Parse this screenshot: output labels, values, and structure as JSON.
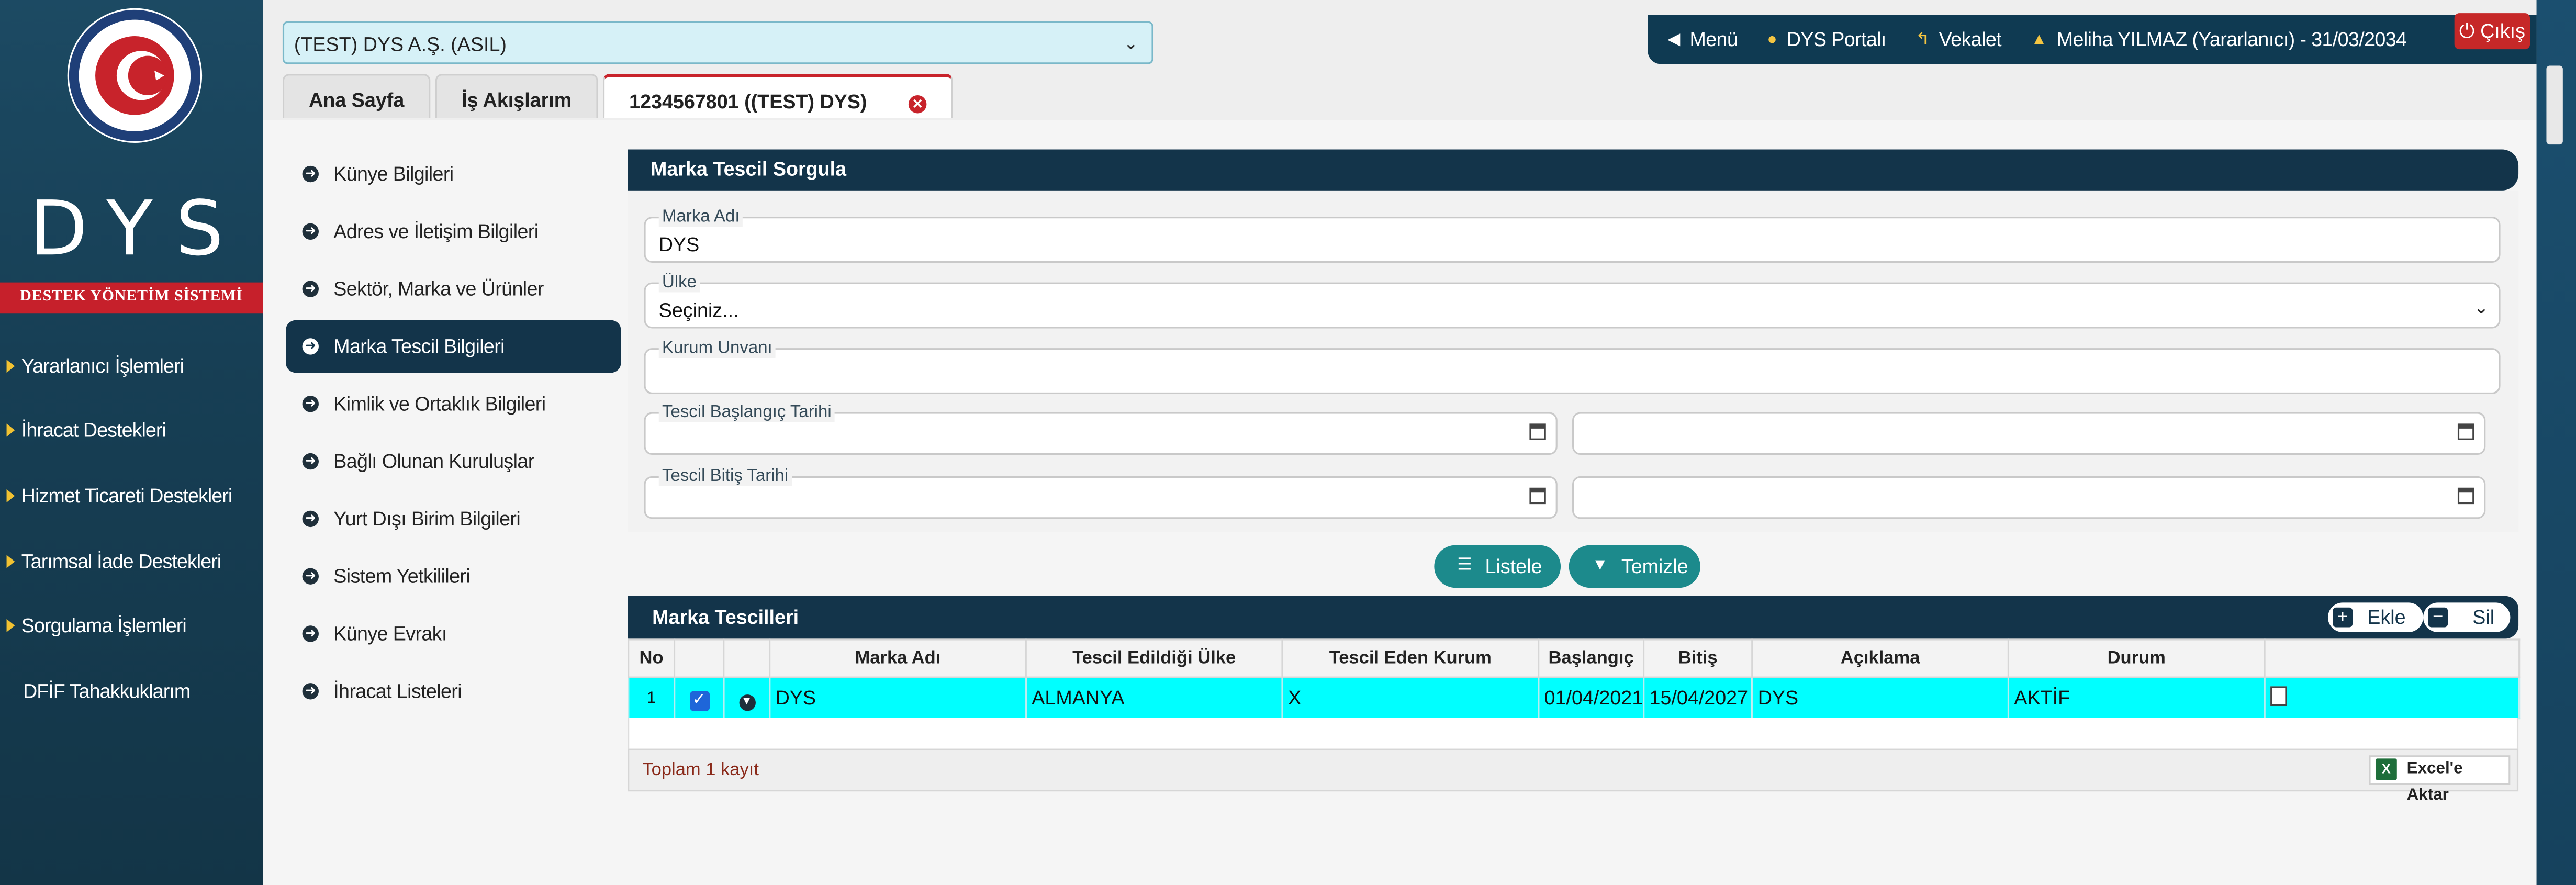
{
  "sidebar": {
    "logo_text": "DYS",
    "banner": "DESTEK YÖNETİM SİSTEMİ",
    "items": [
      {
        "label": "Yararlanıcı İşlemleri"
      },
      {
        "label": "İhracat Destekleri"
      },
      {
        "label": "Hizmet Ticareti Destekleri"
      },
      {
        "label": "Tarımsal İade Destekleri"
      },
      {
        "label": "Sorgulama İşlemleri"
      },
      {
        "label": "DFİF Tahakkuklarım"
      }
    ]
  },
  "header": {
    "company_select": "(TEST) DYS A.Ş. (ASIL)",
    "tabs": [
      {
        "label": "Ana Sayfa"
      },
      {
        "label": "İş Akışlarım"
      },
      {
        "label": "1234567801 ((TEST) DYS)"
      }
    ],
    "topnav": {
      "menu": "Menü",
      "portal": "DYS Portalı",
      "vekalet": "Vekalet",
      "user": "Meliha YILMAZ (Yararlanıcı) - 31/03/2034",
      "exit": "Çıkış"
    }
  },
  "left_nav": [
    {
      "label": "Künye Bilgileri"
    },
    {
      "label": "Adres ve İletişim Bilgileri"
    },
    {
      "label": "Sektör, Marka ve Ürünler"
    },
    {
      "label": "Marka Tescil Bilgileri"
    },
    {
      "label": "Kimlik ve Ortaklık Bilgileri"
    },
    {
      "label": "Bağlı Olunan Kuruluşlar"
    },
    {
      "label": "Yurt Dışı Birim Bilgileri"
    },
    {
      "label": "Sistem Yetkilileri"
    },
    {
      "label": "Künye Evrakı"
    },
    {
      "label": "İhracat Listeleri"
    }
  ],
  "search": {
    "title": "Marka Tescil Sorgula",
    "marka_adi_label": "Marka Adı",
    "marka_adi_value": "DYS",
    "ulke_label": "Ülke",
    "ulke_value": "Seçiniz...",
    "kurum_label": "Kurum Unvanı",
    "kurum_value": "",
    "baslangic_label": "Tescil Başlangıç Tarihi",
    "bitis_label": "Tescil Bitiş Tarihi",
    "listele": "Listele",
    "temizle": "Temizle"
  },
  "results": {
    "title": "Marka Tescilleri",
    "ekle": "Ekle",
    "sil": "Sil",
    "columns": [
      "No",
      "",
      "",
      "Marka Adı",
      "Tescil Edildiği Ülke",
      "Tescil Eden Kurum",
      "Başlangıç",
      "Bitiş",
      "Açıklama",
      "Durum",
      ""
    ],
    "rows": [
      {
        "no": "1",
        "marka": "DYS",
        "ulke": "ALMANYA",
        "kurum": "X",
        "baslangic": "01/04/2021",
        "bitis": "15/04/2027",
        "aciklama": "DYS",
        "durum": "AKTİF"
      }
    ],
    "total": "Toplam 1 kayıt",
    "excel": "Excel'e Aktar"
  },
  "colors": {
    "accent_dark": "#13344a",
    "teal_button": "#1c8a8c",
    "selected_row": "#00ffff",
    "exit_red": "#c62828"
  }
}
